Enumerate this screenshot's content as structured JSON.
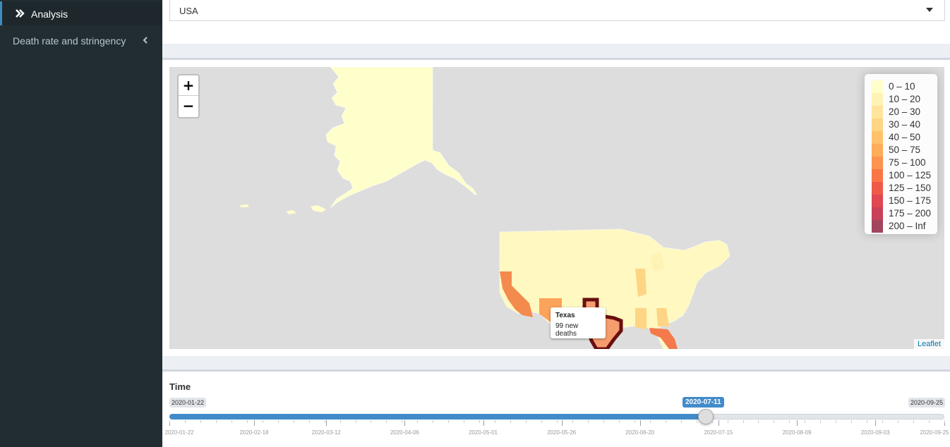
{
  "sidebar": {
    "active_item": {
      "label": "Analysis",
      "icon": "double-chevron-right-icon"
    },
    "items": [
      {
        "label": "Death rate and stringency",
        "icon": "chevron-left-icon"
      }
    ]
  },
  "country_select": {
    "value": "USA"
  },
  "map": {
    "zoom_in": "+",
    "zoom_out": "−",
    "attribution": "Leaflet",
    "legend": [
      {
        "label": "0 – 10",
        "color": "#ffffcc"
      },
      {
        "label": "10 – 20",
        "color": "#fff2b5"
      },
      {
        "label": "20 – 30",
        "color": "#ffe49d"
      },
      {
        "label": "30 – 40",
        "color": "#fed585"
      },
      {
        "label": "40 – 50",
        "color": "#fec26c"
      },
      {
        "label": "50 – 75",
        "color": "#fdac5a"
      },
      {
        "label": "75 – 100",
        "color": "#fc9350"
      },
      {
        "label": "100 – 125",
        "color": "#f97649"
      },
      {
        "label": "125 – 150",
        "color": "#ef5a48"
      },
      {
        "label": "150 – 175",
        "color": "#e04750"
      },
      {
        "label": "175 – 200",
        "color": "#c8405a"
      },
      {
        "label": "200 – Inf",
        "color": "#a3445e"
      }
    ],
    "tooltip": {
      "title": "Texas",
      "text": "99 new deaths"
    }
  },
  "time_slider": {
    "label": "Time",
    "min": "2020-01-22",
    "max": "2020-09-25",
    "value": "2020-07-11",
    "ticks": [
      "2020-01-22",
      "2020-02-18",
      "2020-03-12",
      "2020-04-06",
      "2020-05-01",
      "2020-05-26",
      "2020-06-20",
      "2020-07-15",
      "2020-08-09",
      "2020-09-03",
      "2020-09-25"
    ]
  }
}
